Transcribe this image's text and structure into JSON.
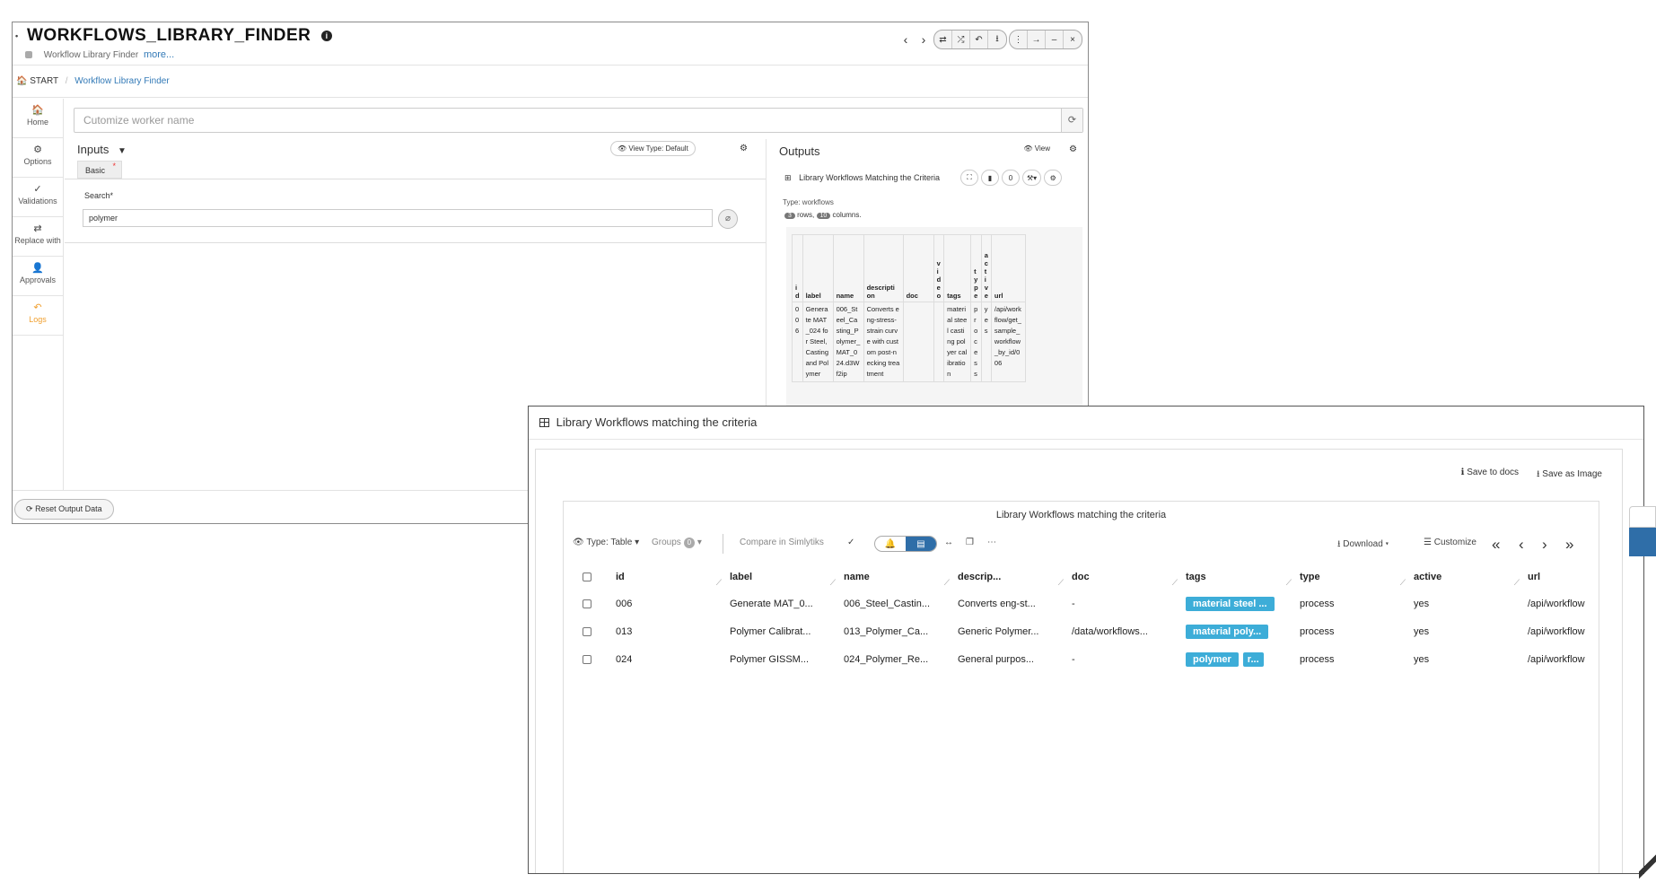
{
  "bg_window": {
    "title": "WORKFLOWS_LIBRARY_FINDER",
    "title_dot": "•",
    "subtitle": "Workflow Library Finder",
    "more_link": "more...",
    "nav_arrows": [
      "‹",
      "›"
    ],
    "ctrl_group1": [
      "⇄",
      "⤮",
      "↶",
      "⭳"
    ],
    "ctrl_group2": [
      "⋮",
      "→",
      "–",
      "×"
    ],
    "breadcrumb": {
      "home": "START",
      "separator": "/",
      "current": "Workflow Library Finder"
    },
    "nav_items": [
      {
        "icon": "home-icon",
        "glyph": "🏠",
        "label": "Home"
      },
      {
        "icon": "gear-icon",
        "glyph": "⚙",
        "label": "Options"
      },
      {
        "icon": "check-icon",
        "glyph": "✓",
        "label": "Validations"
      },
      {
        "icon": "swap-icon",
        "glyph": "⇄",
        "label": "Replace with"
      },
      {
        "icon": "user-check-icon",
        "glyph": "👤",
        "label": "Approvals"
      },
      {
        "icon": "history-icon",
        "glyph": "↶",
        "label": "Logs"
      }
    ],
    "worker_name_placeholder": "Cutomize worker name",
    "inputs": {
      "title": "Inputs",
      "caret": "▼",
      "view_type": "👁 View Type: Default",
      "tab": "Basic",
      "tab_required": "*",
      "search_label": "Search",
      "search_required": "*",
      "search_value": "polymer"
    },
    "outputs": {
      "title": "Outputs",
      "view": "👁 View",
      "lib_title": "Library Workflows Matching the Criteria",
      "lib_buttons": [
        "⛶",
        "▮",
        "0",
        "⚒▾",
        "⚙"
      ],
      "type_line": "Type: workflows",
      "rows_count": "3",
      "rows_text": "rows,",
      "cols_count": "10",
      "cols_text": "columns.",
      "table_headers": [
        "i d",
        "label",
        "name",
        "descripti on",
        "doc",
        "vi d e o",
        "tags",
        "ty p e",
        "a c ti v e",
        "url"
      ],
      "table_row": [
        "0 0 6",
        "Generate MAT_024 for Steel, Casting and Polymer",
        "006_Steel_Casting_Polymer_MAT_024.d3Wf2ip",
        "Converts eng-stress-strain curve with custom post-necking treatment",
        "",
        "",
        "material steel casting polyer calibration",
        "process",
        "yes",
        "/api/workflow/get_sample_workflow_by_id/006"
      ]
    },
    "reset_button": "Reset Output Data"
  },
  "popup": {
    "title": "Library Workflows matching the criteria",
    "save_docs": "Save to docs",
    "save_image": "Save as Image",
    "chart_title": "Library Workflows matching the criteria",
    "toolbar": {
      "type": "Type: Table",
      "groups": "Groups",
      "groups_count": "0",
      "compare": "Compare in Simlytiks",
      "download": "Download",
      "customize": "Customize",
      "pager": [
        "«",
        "‹",
        "›",
        "»"
      ]
    },
    "columns": [
      "id",
      "label",
      "name",
      "descrip...",
      "doc",
      "tags",
      "type",
      "active",
      "url"
    ],
    "rows": [
      {
        "id": "006",
        "label": "Generate MAT_0...",
        "name": "006_Steel_Castin...",
        "desc": "Converts eng-st...",
        "doc": "-",
        "tag1": "material steel ...",
        "tag2": "",
        "type": "process",
        "active": "yes",
        "url": "/api/workflow"
      },
      {
        "id": "013",
        "label": "Polymer Calibrat...",
        "name": "013_Polymer_Ca...",
        "desc": "Generic Polymer...",
        "doc": "/data/workflows...",
        "tag1": "material poly...",
        "tag2": "",
        "type": "process",
        "active": "yes",
        "url": "/api/workflow"
      },
      {
        "id": "024",
        "label": "Polymer GISSM...",
        "name": "024_Polymer_Re...",
        "desc": "General purpos...",
        "doc": "-",
        "tag1": "polymer",
        "tag2": "r...",
        "type": "process",
        "active": "yes",
        "url": "/api/workflow"
      }
    ]
  },
  "colors": {
    "accent_blue": "#2f6ea8",
    "tag_blue": "#3dadd8",
    "link_blue": "#337ab7",
    "active_orange": "#f0a030"
  }
}
